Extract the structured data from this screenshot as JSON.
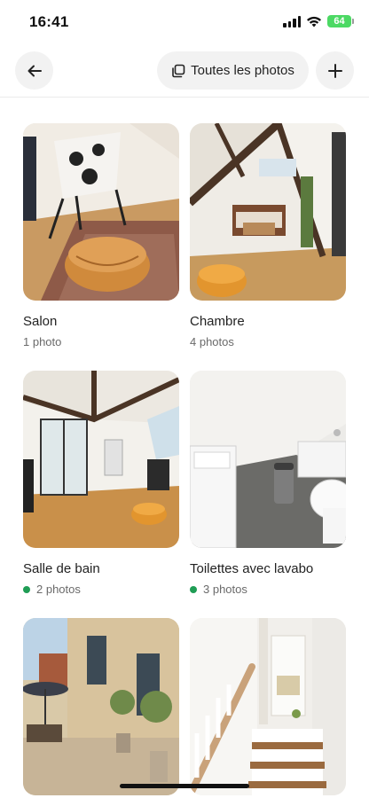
{
  "status_bar": {
    "time": "16:41",
    "battery": "64"
  },
  "nav": {
    "all_photos_label": "Toutes les photos"
  },
  "rooms": [
    {
      "title": "Salon",
      "count": "1 photo",
      "dot": false
    },
    {
      "title": "Chambre",
      "count": "4 photos",
      "dot": false
    },
    {
      "title": "Salle de bain",
      "count": "2 photos",
      "dot": true
    },
    {
      "title": "Toilettes avec lavabo",
      "count": "3 photos",
      "dot": true
    },
    {
      "title": "",
      "count": "",
      "dot": false
    },
    {
      "title": "",
      "count": "",
      "dot": false
    }
  ],
  "colors": {
    "dot": "#1f9d55",
    "battery": "#4cd964"
  }
}
